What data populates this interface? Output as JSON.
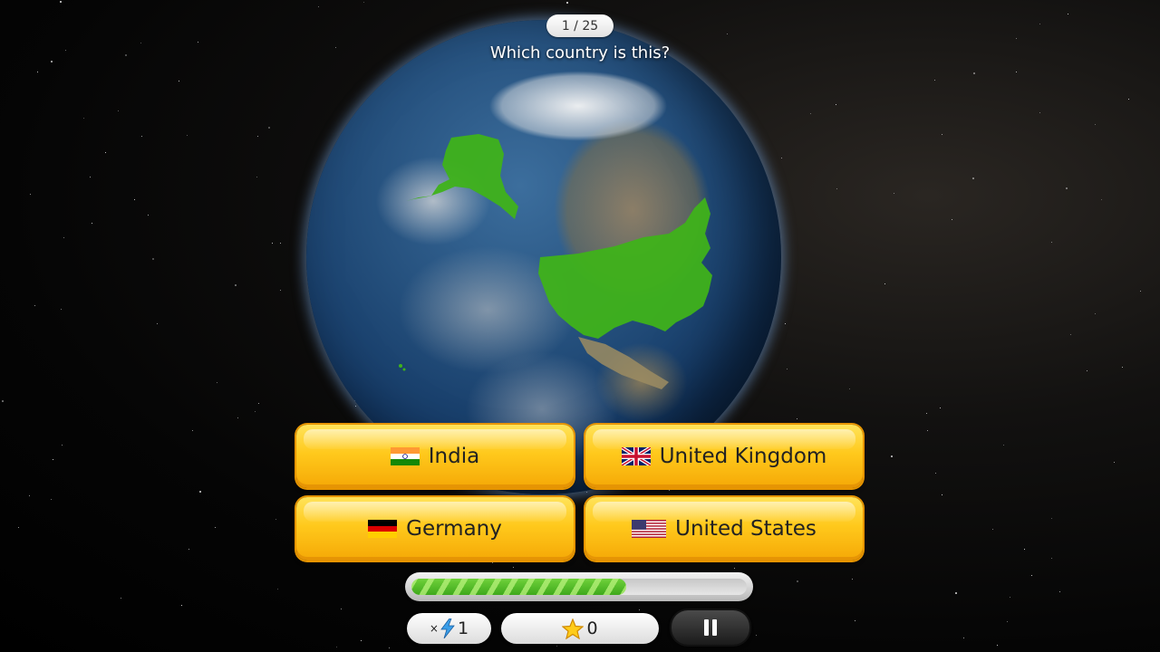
{
  "header": {
    "counter": "1 / 25",
    "question": "Which country is this?"
  },
  "answers": [
    {
      "label": "India",
      "flag": "india-flag-icon"
    },
    {
      "label": "United Kingdom",
      "flag": "uk-flag-icon"
    },
    {
      "label": "Germany",
      "flag": "germany-flag-icon"
    },
    {
      "label": "United States",
      "flag": "usa-flag-icon"
    }
  ],
  "progress": {
    "fraction": 0.64,
    "color": "#4cbc24"
  },
  "footer": {
    "multiplier_prefix": "×",
    "multiplier_value": "1",
    "multiplier_icon": "lightning-icon",
    "stars_value": "0",
    "stars_icon": "star-icon",
    "pause_icon": "pause-icon"
  },
  "colors": {
    "button_yellow": "#ffc91c",
    "highlight_green": "#3fb21a",
    "ocean_blue": "#244f7c"
  }
}
